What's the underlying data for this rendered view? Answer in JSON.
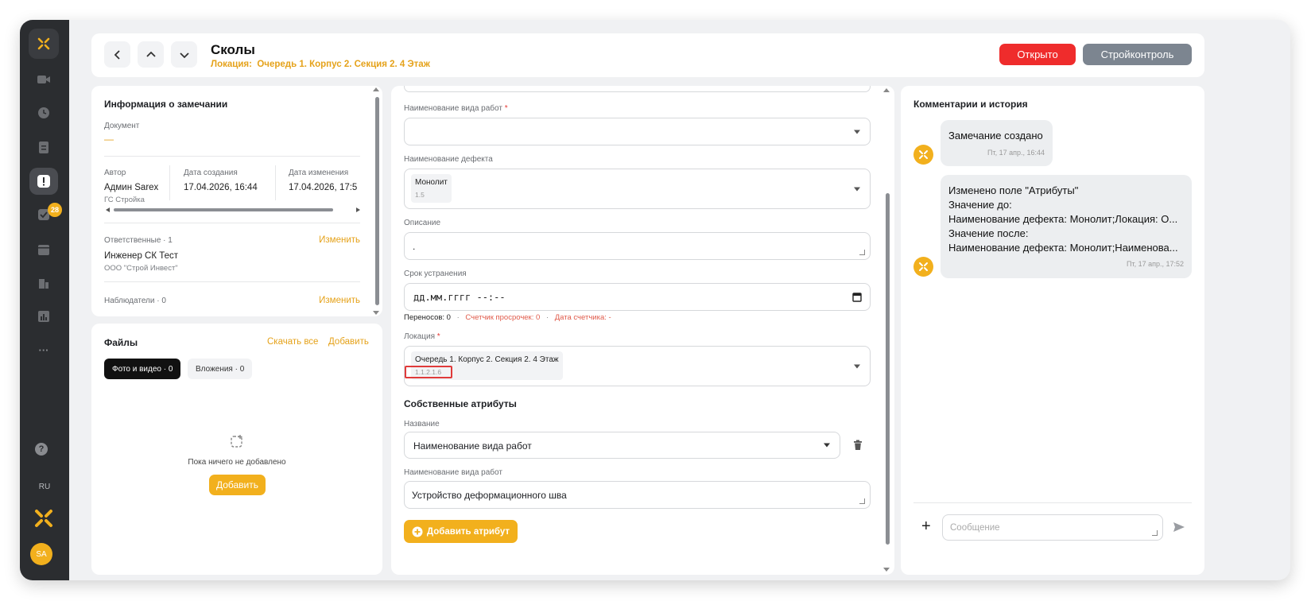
{
  "sidebar": {
    "badge_count": "28",
    "language": "RU",
    "avatar_initials": "SA",
    "help": "?",
    "more": "···"
  },
  "header": {
    "title": "Сколы",
    "location_label": "Локация:",
    "location_value": "Очередь 1. Корпус 2. Секция 2. 4 Этаж",
    "status_button": "Открыто",
    "role_button": "Стройконтроль"
  },
  "info": {
    "heading": "Информация о замечании",
    "document_label": "Документ",
    "document_value": "—",
    "author_label": "Автор",
    "author_name": "Админ Sarex",
    "author_org": "ГС Стройка",
    "created_label": "Дата создания",
    "created_value": "17.04.2026, 16:44",
    "modified_label": "Дата изменения",
    "modified_value": "17.04.2026, 17:5",
    "responsible_label": "Ответственные · 1",
    "responsible_change": "Изменить",
    "responsible_name": "Инженер СК Тест",
    "responsible_org": "ООО \"Строй Инвест\"",
    "observers_label": "Наблюдатели · 0",
    "observers_change": "Изменить"
  },
  "files": {
    "heading": "Файлы",
    "download_all": "Скачать все",
    "add_link": "Добавить",
    "tab_photo": "Фото и видео · 0",
    "tab_attach": "Вложения · 0",
    "empty_text": "Пока ничего не добавлено",
    "add_button": "Добавить"
  },
  "form": {
    "work_type_label": "Наименование вида работ",
    "required_mark": "*",
    "defect_label": "Наименование дефекта",
    "defect_value": "Монолит",
    "defect_code": "1.5",
    "description_label": "Описание",
    "description_value": ".",
    "deadline_label": "Срок устранения",
    "deadline_placeholder": "дд.мм.гггг --:--",
    "transfers": "Переносов: 0",
    "overdue_counter": "Счетчик просрочек: 0",
    "counter_date": "Дата счетчика: -",
    "location_label": "Локация",
    "location_value": "Очередь 1. Корпус 2. Секция 2. 4 Этаж",
    "location_code": "1.1.2.1.6",
    "own_attrs_heading": "Собственные атрибуты",
    "attr_name_label": "Название",
    "attr_name_value": "Наименование вида работ",
    "attr_value_label": "Наименование вида работ",
    "attr_value_value": "Устройство деформационного шва",
    "add_attr_button": "Добавить атрибут"
  },
  "comments": {
    "heading": "Комментарии и история",
    "items": [
      {
        "text": "Замечание создано",
        "time": "Пт, 17 апр., 16:44"
      },
      {
        "lines": [
          "Изменено поле \"Атрибуты\"",
          "Значение до:",
          "Наименование дефекта: Монолит;Локация: О...",
          "Значение после:",
          "Наименование дефекта: Монолит;Наименова..."
        ],
        "time": "Пт, 17 апр., 17:52"
      }
    ],
    "input_placeholder": "Сообщение",
    "add_symbol": "+"
  },
  "colors": {
    "accent": "#f2b01d",
    "danger": "#ef2c2c",
    "secondary": "#7c8590",
    "rail": "#2b2d30"
  }
}
